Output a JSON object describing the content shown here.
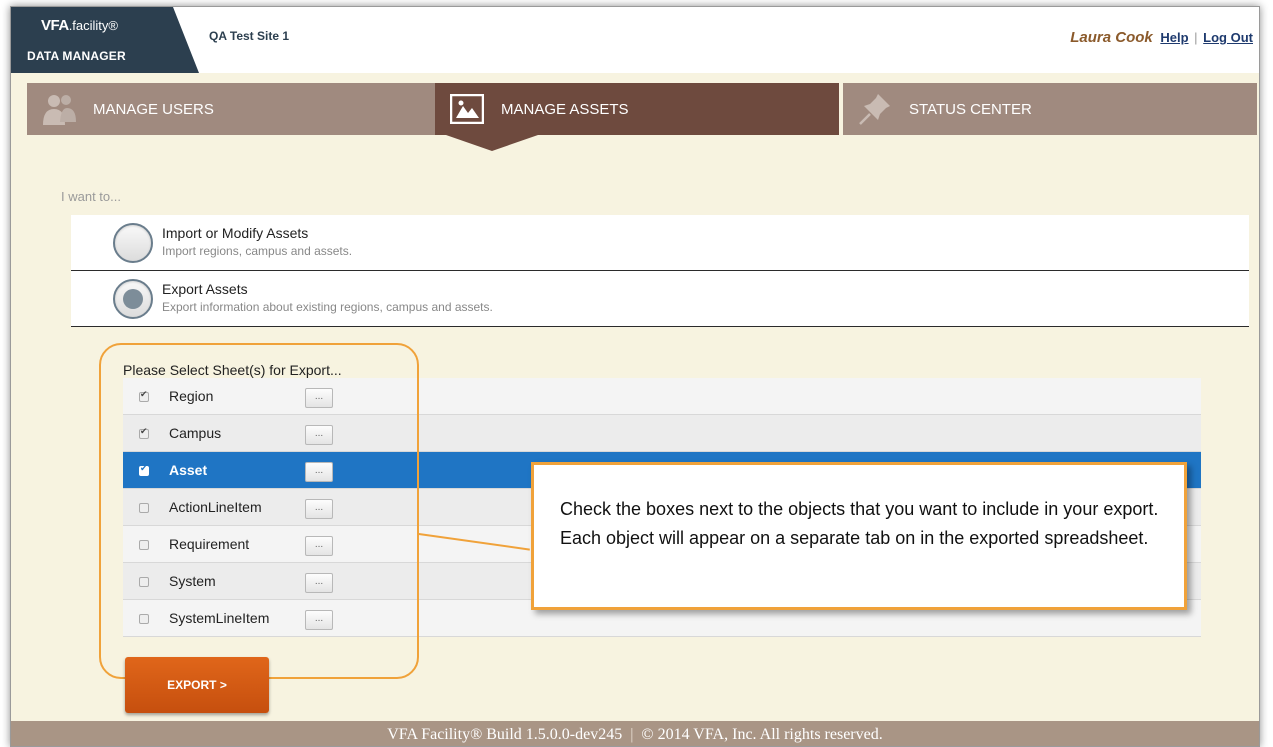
{
  "header": {
    "logo_brand": "VFA",
    "logo_product": ".facility®",
    "logo_subtitle": "DATA MANAGER",
    "site_name": "QA Test Site 1",
    "user_name": "Laura Cook",
    "help_label": "Help",
    "separator": "|",
    "logout_label": "Log Out"
  },
  "tabs": [
    {
      "label": "MANAGE USERS",
      "icon": "users-icon",
      "active": false
    },
    {
      "label": "MANAGE ASSETS",
      "icon": "assets-image-icon",
      "active": true
    },
    {
      "label": "STATUS CENTER",
      "icon": "pushpin-icon",
      "active": false
    }
  ],
  "main": {
    "prompt": "I want to...",
    "options": [
      {
        "title": "Import or Modify Assets",
        "description": "Import regions, campus and assets.",
        "selected": false
      },
      {
        "title": "Export Assets",
        "description": "Export information about existing regions, campus and assets.",
        "selected": true
      }
    ],
    "sheet_select_label": "Please Select Sheet(s) for Export...",
    "sheets": [
      {
        "name": "Region",
        "checked": true,
        "button": "..."
      },
      {
        "name": "Campus",
        "checked": true,
        "button": "..."
      },
      {
        "name": "Asset",
        "checked": true,
        "button": "..."
      },
      {
        "name": "ActionLineItem",
        "checked": false,
        "button": "..."
      },
      {
        "name": "Requirement",
        "checked": false,
        "button": "..."
      },
      {
        "name": "System",
        "checked": false,
        "button": "..."
      },
      {
        "name": "SystemLineItem",
        "checked": false,
        "button": "..."
      }
    ],
    "export_button": "EXPORT >"
  },
  "callout": {
    "text": "Check the boxes next to the objects that you want to include in your export.  Each object will appear on a separate tab on in the exported spreadsheet."
  },
  "footer": {
    "build": "VFA Facility® Build 1.5.0.0-dev245",
    "separator": "|",
    "copyright": "© 2014 VFA, Inc. All rights reserved."
  },
  "colors": {
    "tab_active": "#6e4a3e",
    "tab_inactive": "#a08a7f",
    "selection": "#1f75c4",
    "callout_border": "#f0a23a",
    "export_button": "#d85a12"
  }
}
